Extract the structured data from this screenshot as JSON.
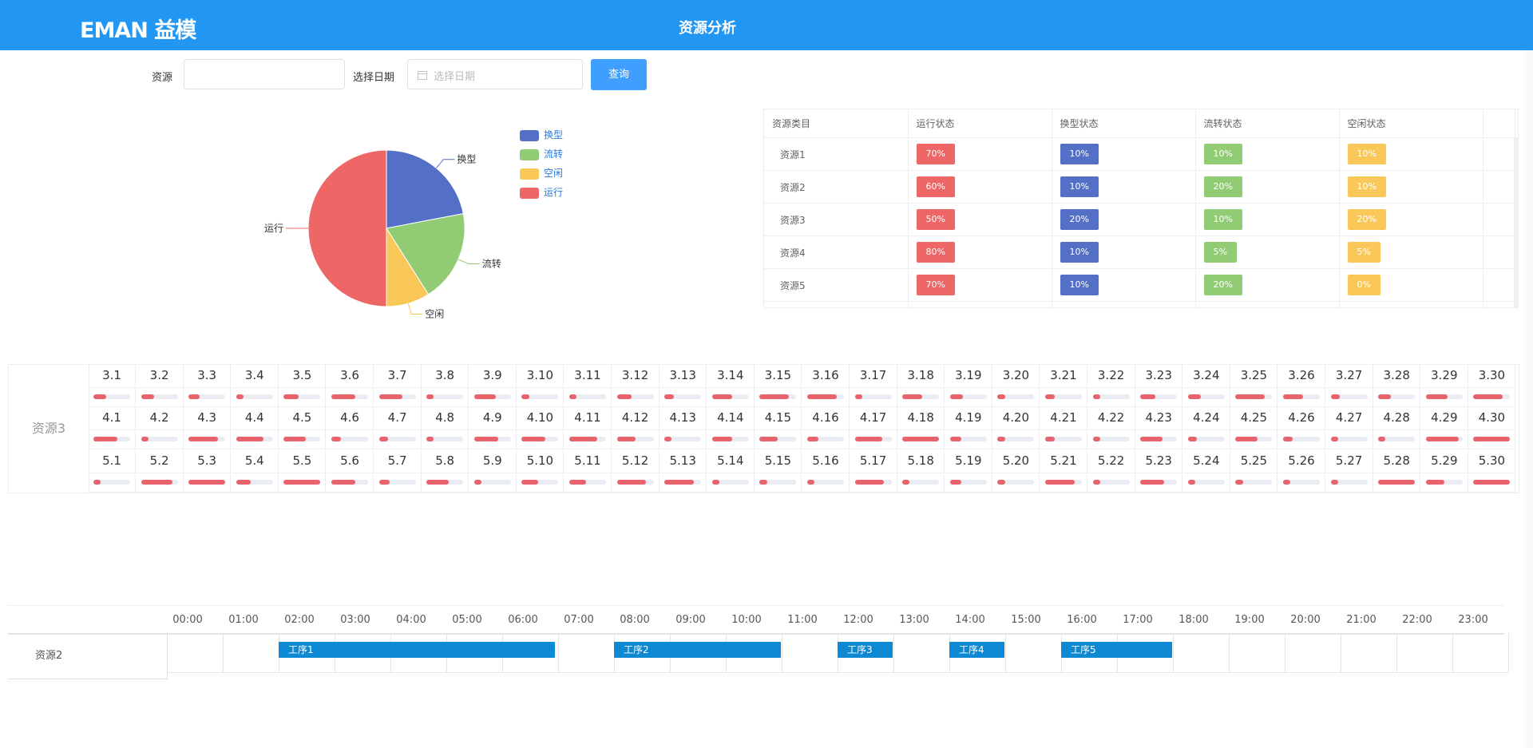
{
  "header": {
    "logo": "EMAN 益模",
    "title": "资源分析"
  },
  "search": {
    "resource_label": "资源",
    "resource_value": "",
    "date_label": "选择日期",
    "date_placeholder": "选择日期",
    "query_button": "查询"
  },
  "pie": {
    "legend": [
      {
        "name": "换型",
        "color": "#5470c6"
      },
      {
        "name": "流转",
        "color": "#91cc75"
      },
      {
        "name": "空闲",
        "color": "#fac858"
      },
      {
        "name": "运行",
        "color": "#ee6666"
      }
    ]
  },
  "chart_data": {
    "type": "pie",
    "slices": [
      {
        "label": "换型",
        "value": 22,
        "color": "#5470c6"
      },
      {
        "label": "流转",
        "value": 19,
        "color": "#91cc75"
      },
      {
        "label": "空闲",
        "value": 9,
        "color": "#fac858"
      },
      {
        "label": "运行",
        "value": 50,
        "color": "#ee6666"
      }
    ]
  },
  "status_table": {
    "headers": [
      "资源类目",
      "运行状态",
      "换型状态",
      "流转状态",
      "空闲状态"
    ],
    "colors": [
      "#ee6666",
      "#5470c6",
      "#91cc75",
      "#fac858"
    ],
    "rows": [
      {
        "name": "资源1",
        "vals": [
          "70%",
          "10%",
          "10%",
          "10%"
        ]
      },
      {
        "name": "资源2",
        "vals": [
          "60%",
          "10%",
          "20%",
          "10%"
        ]
      },
      {
        "name": "资源3",
        "vals": [
          "50%",
          "20%",
          "10%",
          "20%"
        ]
      },
      {
        "name": "资源4",
        "vals": [
          "80%",
          "10%",
          "5%",
          "5%"
        ]
      },
      {
        "name": "资源5",
        "vals": [
          "70%",
          "10%",
          "20%",
          "0%"
        ]
      },
      {
        "name": "",
        "vals": [
          "",
          "",
          "",
          ""
        ]
      }
    ]
  },
  "calendar": {
    "resource": "资源3",
    "rows": [
      {
        "days": [
          "3.1",
          "3.2",
          "3.3",
          "3.4",
          "3.5",
          "3.6",
          "3.7",
          "3.8",
          "3.9",
          "3.10",
          "3.11",
          "3.12",
          "3.13",
          "3.14",
          "3.15",
          "3.16",
          "3.17",
          "3.18",
          "3.19",
          "3.20",
          "3.21",
          "3.22",
          "3.23",
          "3.24",
          "3.25",
          "3.26",
          "3.27",
          "3.28",
          "3.29",
          "3.30"
        ],
        "levels": [
          0.35,
          0.35,
          0.3,
          0.2,
          0.4,
          0.65,
          0.65,
          0.2,
          0.6,
          0.2,
          0.2,
          0.4,
          0.25,
          0.55,
          0.8,
          0.8,
          0.2,
          0.55,
          0.35,
          0.2,
          0.25,
          0.2,
          0.4,
          0.35,
          0.8,
          0.55,
          0.25,
          0.35,
          0.6,
          0.8
        ]
      },
      {
        "days": [
          "4.1",
          "4.2",
          "4.3",
          "4.4",
          "4.5",
          "4.6",
          "4.7",
          "4.8",
          "4.9",
          "4.10",
          "4.11",
          "4.12",
          "4.13",
          "4.14",
          "4.15",
          "4.16",
          "4.17",
          "4.18",
          "4.19",
          "4.20",
          "4.21",
          "4.22",
          "4.23",
          "4.24",
          "4.25",
          "4.26",
          "4.27",
          "4.28",
          "4.29",
          "4.30"
        ],
        "levels": [
          0.65,
          0.2,
          0.8,
          0.75,
          0.6,
          0.25,
          0.25,
          0.2,
          0.65,
          0.65,
          0.75,
          0.5,
          0.2,
          0.55,
          0.5,
          0.3,
          0.75,
          0.99,
          0.3,
          0.2,
          0.25,
          0.2,
          0.6,
          0.25,
          0.6,
          0.25,
          0.2,
          0.2,
          0.9,
          0.99
        ]
      },
      {
        "days": [
          "5.1",
          "5.2",
          "5.3",
          "5.4",
          "5.5",
          "5.6",
          "5.7",
          "5.8",
          "5.9",
          "5.10",
          "5.11",
          "5.12",
          "5.13",
          "5.14",
          "5.15",
          "5.16",
          "5.17",
          "5.18",
          "5.19",
          "5.20",
          "5.21",
          "5.22",
          "5.23",
          "5.24",
          "5.25",
          "5.26",
          "5.27",
          "5.28",
          "5.29",
          "5.30"
        ],
        "levels": [
          0.2,
          0.85,
          0.99,
          0.4,
          0.99,
          0.65,
          0.3,
          0.6,
          0.2,
          0.45,
          0.45,
          0.8,
          0.8,
          0.2,
          0.2,
          0.2,
          0.8,
          0.2,
          0.3,
          0.2,
          0.8,
          0.2,
          0.65,
          0.2,
          0.2,
          0.2,
          0.2,
          0.99,
          0.5,
          0.99
        ]
      }
    ]
  },
  "gantt": {
    "hours": [
      "00:00",
      "01:00",
      "02:00",
      "03:00",
      "04:00",
      "05:00",
      "06:00",
      "07:00",
      "08:00",
      "09:00",
      "10:00",
      "11:00",
      "12:00",
      "13:00",
      "14:00",
      "15:00",
      "16:00",
      "17:00",
      "18:00",
      "19:00",
      "20:00",
      "21:00",
      "22:00",
      "23:00"
    ],
    "resource": "资源2",
    "tasks": [
      {
        "label": "工序1",
        "start": 2,
        "end": 6.95
      },
      {
        "label": "工序2",
        "start": 8,
        "end": 11
      },
      {
        "label": "工序3",
        "start": 12,
        "end": 13
      },
      {
        "label": "工序4",
        "start": 14,
        "end": 15
      },
      {
        "label": "工序5",
        "start": 16,
        "end": 18
      }
    ]
  }
}
